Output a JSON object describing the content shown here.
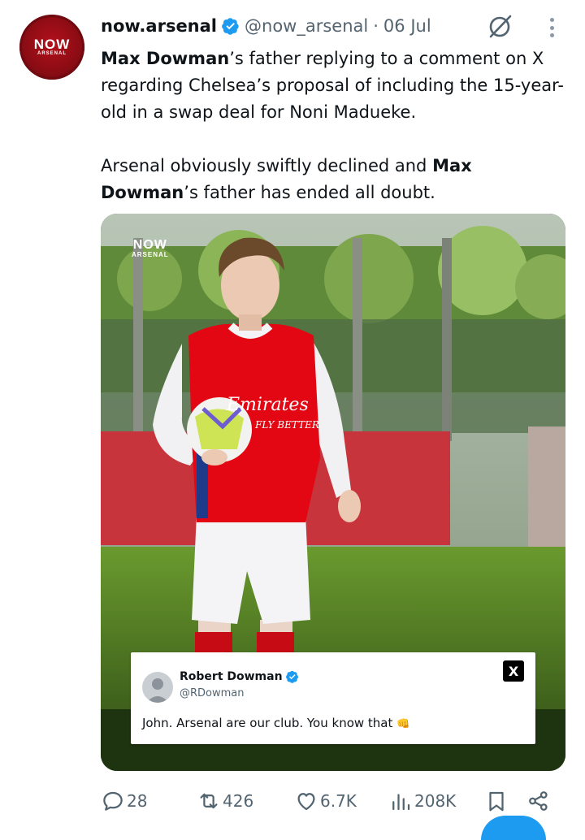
{
  "post": {
    "display_name": "now.arsenal",
    "handle": "@now_arsenal",
    "separator": "·",
    "date": "06 Jul",
    "paragraph1": {
      "bold1": "Max Dowman",
      "text1": "’s father replying to a comment on X regarding Chelsea’s proposal of including the 15-year-old in a swap deal for Noni Madueke."
    },
    "paragraph2": {
      "text1": "Arsenal obviously swiftly declined and ",
      "bold1": "Max Dowman",
      "text2": "’s father has ended all doubt."
    },
    "avatar_logo": {
      "line1": "NOW",
      "line2": "ARSENAL"
    }
  },
  "media": {
    "watermark": {
      "line1": "NOW",
      "line2": "ARSENAL"
    },
    "shirt_sponsor": {
      "line1": "Emirates",
      "line2": "FLY BETTER"
    },
    "embedded_reply": {
      "name": "Robert Dowman",
      "handle": "@RDowman",
      "text": "John. Arsenal are our club. You know that",
      "emoji": "👊",
      "x_logo": "X"
    }
  },
  "actions": {
    "replies": "28",
    "reposts": "426",
    "likes": "6.7K",
    "views": "208K",
    "icons": [
      "reply-icon",
      "repost-icon",
      "like-icon",
      "views-icon",
      "bookmark-icon",
      "share-icon"
    ]
  },
  "colors": {
    "accent": "#1d9bf0",
    "muted": "#536471",
    "arsenal_red": "#db0007"
  }
}
